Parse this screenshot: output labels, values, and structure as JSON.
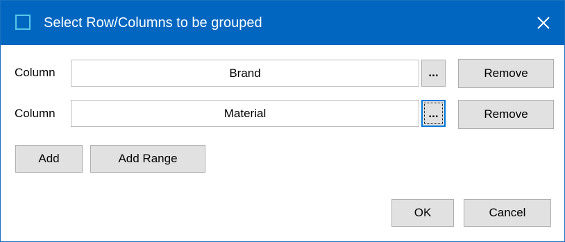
{
  "dialog": {
    "title": "Select Row/Columns to be grouped",
    "close_glyph": "✕",
    "icon": "window-icon",
    "accent_color": "#0066c0"
  },
  "rows": [
    {
      "label": "Column",
      "value": "Brand",
      "browse_label": "...",
      "remove_label": "Remove"
    },
    {
      "label": "Column",
      "value": "Material",
      "browse_label": "...",
      "remove_label": "Remove",
      "focused": true
    }
  ],
  "actions": {
    "add_label": "Add",
    "add_range_label": "Add Range"
  },
  "footer": {
    "ok_label": "OK",
    "cancel_label": "Cancel"
  }
}
